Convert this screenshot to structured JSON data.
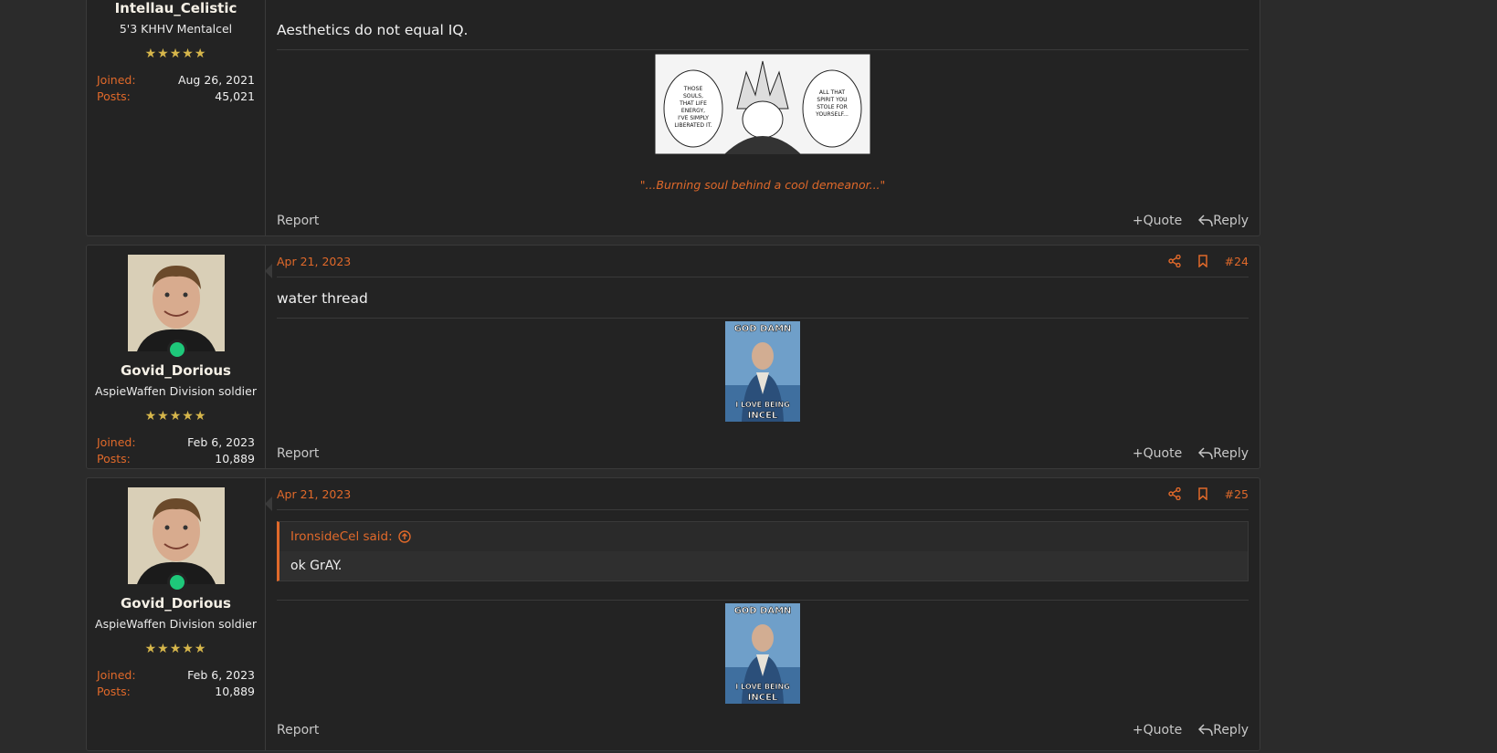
{
  "post1": {
    "username": "Intellau_Celistic",
    "user_title": "5'3 KHHV Mentalcel",
    "stars": "★★★★★",
    "joined_label": "Joined:",
    "joined_value": "Aug 26, 2021",
    "posts_label": "Posts:",
    "posts_value": "45,021",
    "body": "Aesthetics do not equal IQ.",
    "image_text_left": "THOSE SOULS, THAT LIFE ENERGY, I'VE SIMPLY LIBERATED IT.",
    "image_text_right": "ALL THAT SPIRIT YOU STOLE FOR YOURSELF...",
    "signature": "\"...Burning soul behind a cool demeanor...\"",
    "report": "Report",
    "quote": "Quote",
    "reply": "Reply"
  },
  "post2": {
    "date": "Apr 21, 2023",
    "number": "#24",
    "username": "Govid_Dorious",
    "user_title": "AspieWaffen Division soldier",
    "stars": "★★★★★",
    "joined_label": "Joined:",
    "joined_value": "Feb 6, 2023",
    "posts_label": "Posts:",
    "posts_value": "10,889",
    "body": "water thread",
    "meme_top": "GOD DAMN",
    "meme_mid": "I LOVE BEING",
    "meme_bot": "INCEL",
    "report": "Report",
    "quote": "Quote",
    "reply": "Reply"
  },
  "post3": {
    "date": "Apr 21, 2023",
    "number": "#25",
    "username": "Govid_Dorious",
    "user_title": "AspieWaffen Division soldier",
    "stars": "★★★★★",
    "joined_label": "Joined:",
    "joined_value": "Feb 6, 2023",
    "posts_label": "Posts:",
    "posts_value": "10,889",
    "quote_author": "IronsideCel said:",
    "quote_text": "ok GrAY.",
    "meme_top": "GOD DAMN",
    "meme_mid": "I LOVE BEING",
    "meme_bot": "INCEL",
    "report": "Report",
    "quote": "Quote",
    "reply": "Reply"
  },
  "colors": {
    "accent": "#e0692a",
    "online": "#1ec87a",
    "stars": "#d6b64b"
  }
}
